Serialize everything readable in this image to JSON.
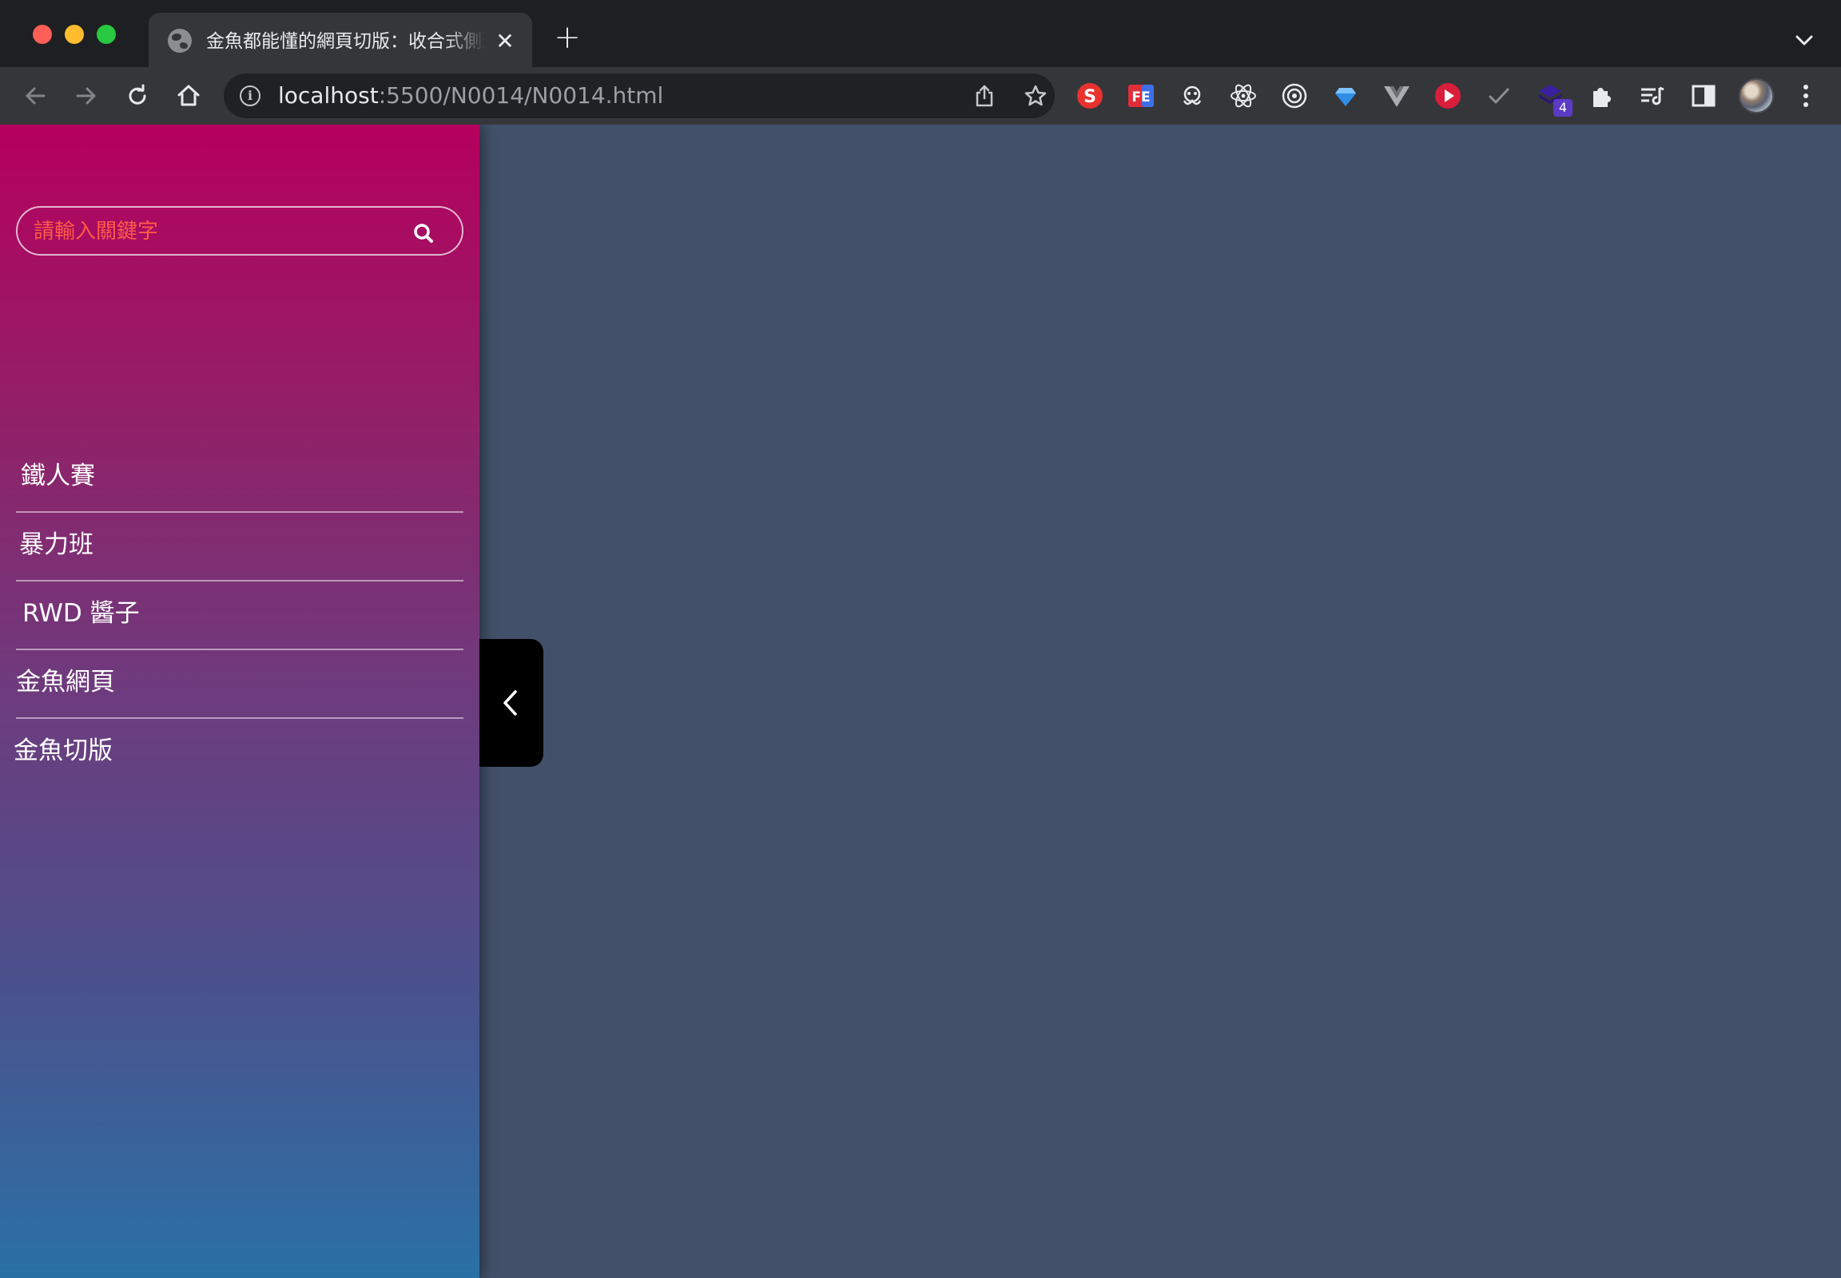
{
  "browser": {
    "tab_title": "金魚都能懂的網頁切版：收合式側邊欄",
    "new_tab_label": "+",
    "close_tab_label": "✕",
    "url_host": "localhost",
    "url_path": ":5500/N0014/N0014.html",
    "extension_badge_count": "4",
    "extension_icons": [
      "scratchpad-s-icon",
      "fe-helper-icon",
      "octopus-icon",
      "react-devtools-icon",
      "target-icon",
      "ruby-gem-icon",
      "vue-devtools-icon",
      "youtube-play-icon",
      "checkmark-icon",
      "stack-ext-icon",
      "puzzle-extensions-icon",
      "reading-list-icon",
      "side-panel-icon"
    ]
  },
  "sidebar": {
    "search_placeholder": "請輸入關鍵字",
    "menu_items": [
      {
        "label": "鐵人賽"
      },
      {
        "label": "暴力班"
      },
      {
        "label": "RWD 醬子"
      },
      {
        "label": "金魚網頁"
      },
      {
        "label": "金魚切版"
      }
    ],
    "gradient_top": "#b5005d",
    "gradient_bottom": "#2a71a6",
    "placeholder_color": "#ff5a46"
  },
  "page": {
    "background": "#425069",
    "toggle_background": "#000000"
  }
}
